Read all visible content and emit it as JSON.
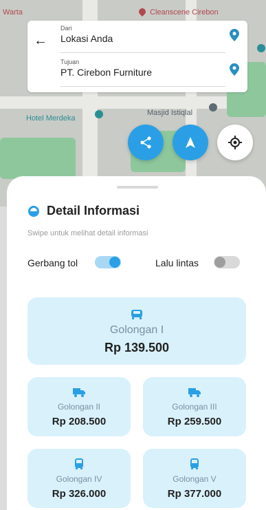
{
  "map": {
    "labels": {
      "top_left": "Warta",
      "top_center": "Cleanscene Cirebon",
      "hotel": "Hotel Merdeka",
      "mosque": "Masjid Istiqlal"
    }
  },
  "route": {
    "from_caption": "Dari",
    "from_value": "Lokasi Anda",
    "to_caption": "Tujuan",
    "to_value": "PT. Cirebon Furniture"
  },
  "sheet": {
    "title": "Detail Informasi",
    "subtitle": "Swipe untuk melihat detail informasi",
    "toggles": [
      {
        "label": "Gerbang tol",
        "on": true
      },
      {
        "label": "Lalu lintas",
        "on": false
      }
    ],
    "classes": [
      {
        "name": "Golongan I",
        "price": "Rp 139.500",
        "icon": "car-icon"
      },
      {
        "name": "Golongan II",
        "price": "Rp 208.500",
        "icon": "truck-icon"
      },
      {
        "name": "Golongan III",
        "price": "Rp 259.500",
        "icon": "truck-icon"
      },
      {
        "name": "Golongan IV",
        "price": "Rp 326.000",
        "icon": "bus-icon"
      },
      {
        "name": "Golongan V",
        "price": "Rp 377.000",
        "icon": "bus-icon"
      }
    ]
  },
  "colors": {
    "accent": "#2A9FE6",
    "card_bg": "#D9F1FB",
    "text": "#222222"
  }
}
